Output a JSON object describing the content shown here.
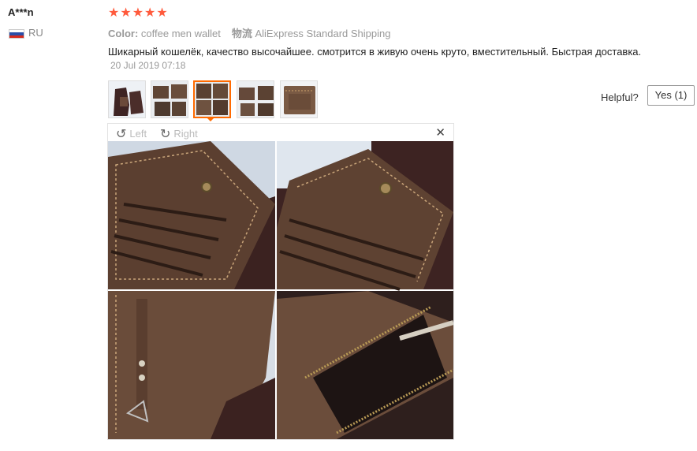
{
  "user": {
    "name": "A***n",
    "country": "RU"
  },
  "rating": {
    "stars": 5,
    "star_glyph": "★"
  },
  "attributes": {
    "color_label": "Color:",
    "color_value": "coffee men wallet",
    "shipping_label": "物流",
    "shipping_value": "AliExpress Standard Shipping"
  },
  "feedback": {
    "text": "Шикарный кошелёк, качество высочайшее. смотрится в живую очень круто, вместительный. Быстрая доставка.",
    "date": "20 Jul 2019 07:18"
  },
  "thumbnails": {
    "count": 5,
    "active_index": 2
  },
  "helpful": {
    "label": "Helpful?",
    "yes_button": "Yes (1)"
  },
  "viewer": {
    "rotate_left_label": "Left",
    "rotate_right_label": "Right",
    "rotate_left_icon": "↺",
    "rotate_right_icon": "↻",
    "close_icon": "✕"
  },
  "colors": {
    "star": "#ff5a3c",
    "active_thumb": "#ff6a00",
    "leather": "#5e4434",
    "bag": "#3b2220"
  }
}
